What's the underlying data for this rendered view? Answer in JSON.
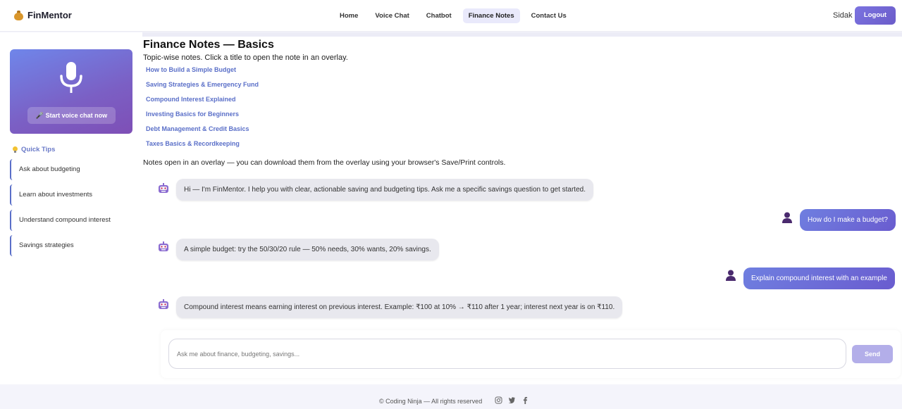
{
  "brand": {
    "name": "FinMentor"
  },
  "nav": {
    "items": [
      {
        "label": "Home"
      },
      {
        "label": "Voice Chat"
      },
      {
        "label": "Chatbot"
      },
      {
        "label": "Finance Notes",
        "active": true
      },
      {
        "label": "Contact Us"
      }
    ]
  },
  "user": {
    "name": "Sidak",
    "logout_label": "Logout"
  },
  "sidebar": {
    "voice_button": "🎤 Start voice chat now",
    "tips_title": "Quick Tips",
    "tips": [
      "Ask about budgeting",
      "Learn about investments",
      "Understand compound interest",
      "Savings strategies"
    ]
  },
  "main": {
    "title": "Finance Notes — Basics",
    "subtitle": "Topic-wise notes. Click a title to open the note in an overlay.",
    "notes": [
      "How to Build a Simple Budget",
      "Saving Strategies & Emergency Fund",
      "Compound Interest Explained",
      "Investing Basics for Beginners",
      "Debt Management & Credit Basics",
      "Taxes Basics & Recordkeeping"
    ],
    "hint": "Notes open in an overlay — you can download them from the overlay using your browser's Save/Print controls."
  },
  "chat": {
    "messages": [
      {
        "role": "bot",
        "text": "Hi — I'm FinMentor. I help you with clear, actionable saving and budgeting tips. Ask me a specific savings question to get started."
      },
      {
        "role": "user",
        "text": "How do I make a budget?"
      },
      {
        "role": "bot",
        "text": "A simple budget: try the 50/30/20 rule — 50% needs, 30% wants, 20% savings."
      },
      {
        "role": "user",
        "text": "Explain compound interest with an example"
      },
      {
        "role": "bot",
        "text": "Compound interest means earning interest on previous interest. Example: ₹100 at 10% → ₹110 after 1 year; interest next year is on ₹110."
      }
    ],
    "input_placeholder": "Ask me about finance, budgeting, savings...",
    "send_label": "Send"
  },
  "footer": {
    "text": "© Coding Ninja — All rights reserved",
    "icons": [
      "instagram-icon",
      "twitter-icon",
      "facebook-icon"
    ]
  },
  "colors": {
    "accent": "#6a5ccf",
    "link": "#5a6fc8",
    "bot_bubble": "#e8e8ee"
  }
}
